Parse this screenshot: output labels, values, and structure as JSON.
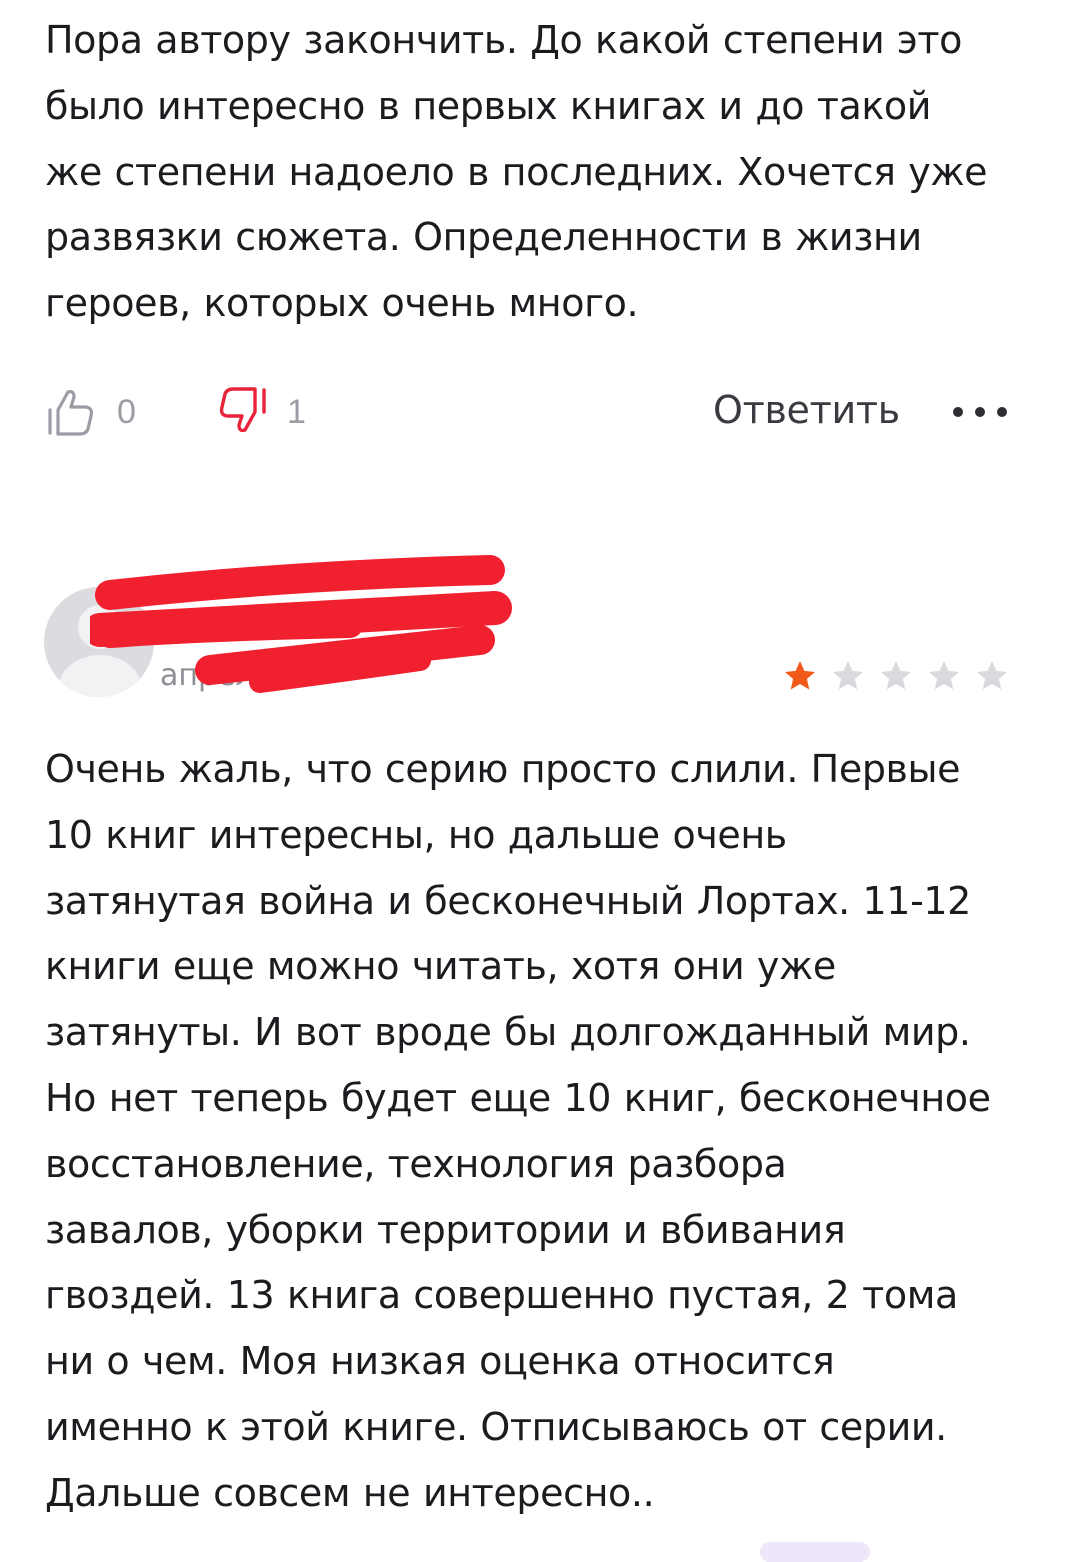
{
  "review1": {
    "lines": [
      "Пора автору закончить. До какой степени это",
      "было интересно в первых книгах и до такой",
      "же степени надоело в последних. Хочется уже",
      "развязки сюжета. Определенности в жизни",
      "героев, которых очень много."
    ],
    "likes": "0",
    "dislikes": "1",
    "reply_label": "Ответить",
    "icons": {
      "like": "thumbs-up-icon",
      "dislike": "thumbs-down-icon",
      "more": "more-dots-icon"
    }
  },
  "review2": {
    "date": "апреля",
    "rating": 1,
    "rating_max": 5,
    "lines": [
      "Очень жаль, что серию просто слили. Первые",
      "10 книг интересны, но дальше очень",
      "затянутая война и бесконечный Лортах. 11-12",
      "книги еще можно читать, хотя они уже",
      "затянуты. И вот вроде бы долгожданный мир.",
      "Но нет теперь будет еще 10 книг, бесконечное",
      "восстановление, технология разбора",
      "завалов, уборки территории и вбивания",
      "гвоздей. 13 книга совершенно пустая, 2 тома",
      "ни о чем. Моя низкая оценка относится",
      "именно к этой книге. Отписываюсь от серии.",
      "Дальше совсем не интересно.."
    ],
    "icons": {
      "avatar": "avatar-placeholder-icon",
      "star": "star-icon"
    }
  },
  "colors": {
    "text": "#1c1c20",
    "muted": "#9c9ca4",
    "star_active": "#f25a19",
    "star_inactive": "#d9d9de",
    "dislike_active": "#e8233a",
    "redaction": "#f0202f"
  }
}
